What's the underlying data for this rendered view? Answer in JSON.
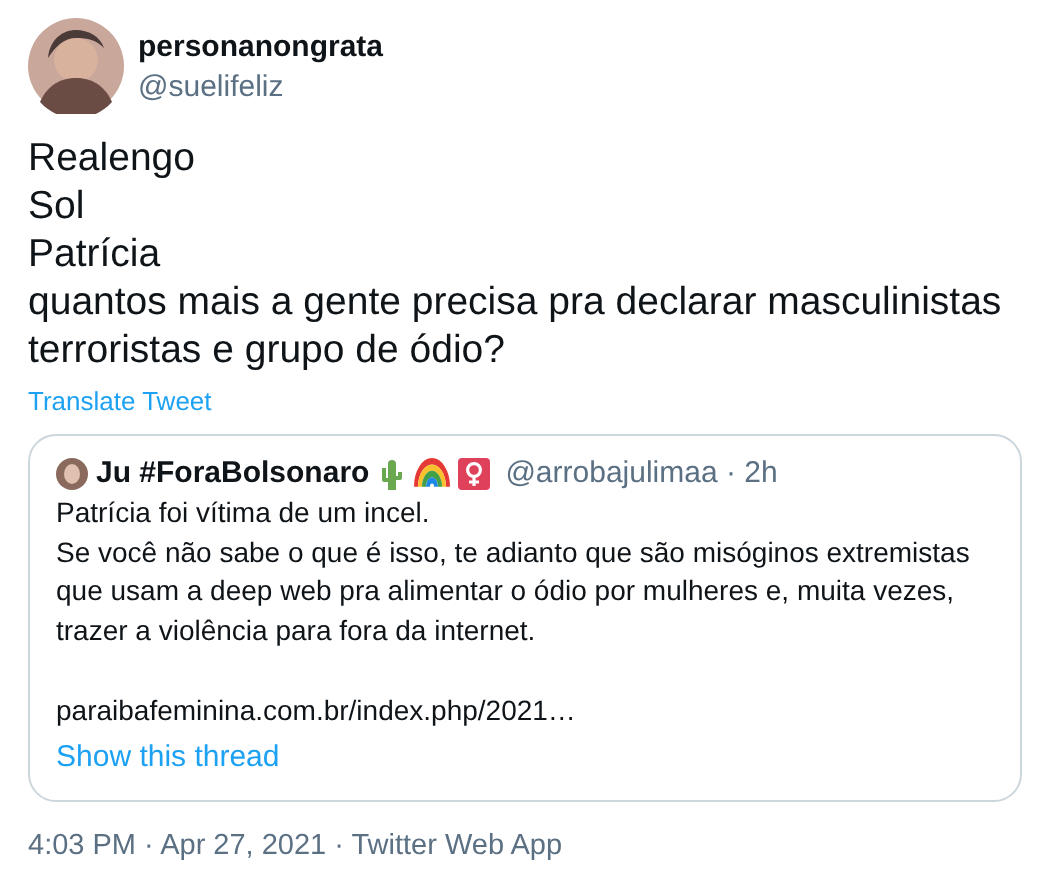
{
  "author": {
    "name": "personanongrata",
    "handle": "@suelifeliz"
  },
  "tweet_lines": [
    "Realengo",
    "Sol",
    "Patrícia",
    "quantos mais a gente precisa pra declarar masculinistas terroristas e grupo de ódio?"
  ],
  "translate_link": "Translate Tweet",
  "quoted_tweet": {
    "name": "Ju #ForaBolsonaro",
    "handle": "@arrobajulimaa",
    "separator": "·",
    "time": "2h",
    "paragraphs": [
      "Patrícia foi vítima de um incel.\nSe você não sabe o que é isso, te adianto que são misóginos extremistas que usam a deep web pra alimentar o ódio por mulheres e, muita vezes, trazer a violência para fora da internet.",
      "paraibafeminina.com.br/index.php/2021…"
    ],
    "show_thread": "Show this thread"
  },
  "footer": {
    "time": "4:03 PM",
    "date": "Apr 27, 2021",
    "source": "Twitter Web App",
    "separator": "·"
  }
}
